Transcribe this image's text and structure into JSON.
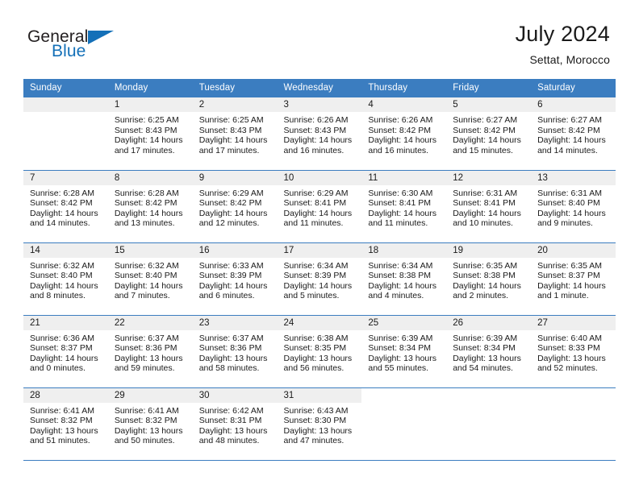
{
  "brand": {
    "word1": "General",
    "word2": "Blue",
    "triangle_icon": "triangle-logo-icon",
    "accent_color": "#1470b8"
  },
  "header": {
    "title": "July 2024",
    "subtitle": "Settat, Morocco"
  },
  "calendar": {
    "header_bg": "#3b7dc0",
    "daynum_bg": "#efefef",
    "columns": [
      "Sunday",
      "Monday",
      "Tuesday",
      "Wednesday",
      "Thursday",
      "Friday",
      "Saturday"
    ],
    "labels": {
      "sunrise": "Sunrise:",
      "sunset": "Sunset:",
      "daylight": "Daylight:"
    },
    "weeks": [
      [
        {
          "day": "",
          "empty": true
        },
        {
          "day": "1",
          "sunrise": "Sunrise: 6:25 AM",
          "sunset": "Sunset: 8:43 PM",
          "daylight1": "Daylight: 14 hours",
          "daylight2": "and 17 minutes."
        },
        {
          "day": "2",
          "sunrise": "Sunrise: 6:25 AM",
          "sunset": "Sunset: 8:43 PM",
          "daylight1": "Daylight: 14 hours",
          "daylight2": "and 17 minutes."
        },
        {
          "day": "3",
          "sunrise": "Sunrise: 6:26 AM",
          "sunset": "Sunset: 8:43 PM",
          "daylight1": "Daylight: 14 hours",
          "daylight2": "and 16 minutes."
        },
        {
          "day": "4",
          "sunrise": "Sunrise: 6:26 AM",
          "sunset": "Sunset: 8:42 PM",
          "daylight1": "Daylight: 14 hours",
          "daylight2": "and 16 minutes."
        },
        {
          "day": "5",
          "sunrise": "Sunrise: 6:27 AM",
          "sunset": "Sunset: 8:42 PM",
          "daylight1": "Daylight: 14 hours",
          "daylight2": "and 15 minutes."
        },
        {
          "day": "6",
          "sunrise": "Sunrise: 6:27 AM",
          "sunset": "Sunset: 8:42 PM",
          "daylight1": "Daylight: 14 hours",
          "daylight2": "and 14 minutes."
        }
      ],
      [
        {
          "day": "7",
          "sunrise": "Sunrise: 6:28 AM",
          "sunset": "Sunset: 8:42 PM",
          "daylight1": "Daylight: 14 hours",
          "daylight2": "and 14 minutes."
        },
        {
          "day": "8",
          "sunrise": "Sunrise: 6:28 AM",
          "sunset": "Sunset: 8:42 PM",
          "daylight1": "Daylight: 14 hours",
          "daylight2": "and 13 minutes."
        },
        {
          "day": "9",
          "sunrise": "Sunrise: 6:29 AM",
          "sunset": "Sunset: 8:42 PM",
          "daylight1": "Daylight: 14 hours",
          "daylight2": "and 12 minutes."
        },
        {
          "day": "10",
          "sunrise": "Sunrise: 6:29 AM",
          "sunset": "Sunset: 8:41 PM",
          "daylight1": "Daylight: 14 hours",
          "daylight2": "and 11 minutes."
        },
        {
          "day": "11",
          "sunrise": "Sunrise: 6:30 AM",
          "sunset": "Sunset: 8:41 PM",
          "daylight1": "Daylight: 14 hours",
          "daylight2": "and 11 minutes."
        },
        {
          "day": "12",
          "sunrise": "Sunrise: 6:31 AM",
          "sunset": "Sunset: 8:41 PM",
          "daylight1": "Daylight: 14 hours",
          "daylight2": "and 10 minutes."
        },
        {
          "day": "13",
          "sunrise": "Sunrise: 6:31 AM",
          "sunset": "Sunset: 8:40 PM",
          "daylight1": "Daylight: 14 hours",
          "daylight2": "and 9 minutes."
        }
      ],
      [
        {
          "day": "14",
          "sunrise": "Sunrise: 6:32 AM",
          "sunset": "Sunset: 8:40 PM",
          "daylight1": "Daylight: 14 hours",
          "daylight2": "and 8 minutes."
        },
        {
          "day": "15",
          "sunrise": "Sunrise: 6:32 AM",
          "sunset": "Sunset: 8:40 PM",
          "daylight1": "Daylight: 14 hours",
          "daylight2": "and 7 minutes."
        },
        {
          "day": "16",
          "sunrise": "Sunrise: 6:33 AM",
          "sunset": "Sunset: 8:39 PM",
          "daylight1": "Daylight: 14 hours",
          "daylight2": "and 6 minutes."
        },
        {
          "day": "17",
          "sunrise": "Sunrise: 6:34 AM",
          "sunset": "Sunset: 8:39 PM",
          "daylight1": "Daylight: 14 hours",
          "daylight2": "and 5 minutes."
        },
        {
          "day": "18",
          "sunrise": "Sunrise: 6:34 AM",
          "sunset": "Sunset: 8:38 PM",
          "daylight1": "Daylight: 14 hours",
          "daylight2": "and 4 minutes."
        },
        {
          "day": "19",
          "sunrise": "Sunrise: 6:35 AM",
          "sunset": "Sunset: 8:38 PM",
          "daylight1": "Daylight: 14 hours",
          "daylight2": "and 2 minutes."
        },
        {
          "day": "20",
          "sunrise": "Sunrise: 6:35 AM",
          "sunset": "Sunset: 8:37 PM",
          "daylight1": "Daylight: 14 hours",
          "daylight2": "and 1 minute."
        }
      ],
      [
        {
          "day": "21",
          "sunrise": "Sunrise: 6:36 AM",
          "sunset": "Sunset: 8:37 PM",
          "daylight1": "Daylight: 14 hours",
          "daylight2": "and 0 minutes."
        },
        {
          "day": "22",
          "sunrise": "Sunrise: 6:37 AM",
          "sunset": "Sunset: 8:36 PM",
          "daylight1": "Daylight: 13 hours",
          "daylight2": "and 59 minutes."
        },
        {
          "day": "23",
          "sunrise": "Sunrise: 6:37 AM",
          "sunset": "Sunset: 8:36 PM",
          "daylight1": "Daylight: 13 hours",
          "daylight2": "and 58 minutes."
        },
        {
          "day": "24",
          "sunrise": "Sunrise: 6:38 AM",
          "sunset": "Sunset: 8:35 PM",
          "daylight1": "Daylight: 13 hours",
          "daylight2": "and 56 minutes."
        },
        {
          "day": "25",
          "sunrise": "Sunrise: 6:39 AM",
          "sunset": "Sunset: 8:34 PM",
          "daylight1": "Daylight: 13 hours",
          "daylight2": "and 55 minutes."
        },
        {
          "day": "26",
          "sunrise": "Sunrise: 6:39 AM",
          "sunset": "Sunset: 8:34 PM",
          "daylight1": "Daylight: 13 hours",
          "daylight2": "and 54 minutes."
        },
        {
          "day": "27",
          "sunrise": "Sunrise: 6:40 AM",
          "sunset": "Sunset: 8:33 PM",
          "daylight1": "Daylight: 13 hours",
          "daylight2": "and 52 minutes."
        }
      ],
      [
        {
          "day": "28",
          "sunrise": "Sunrise: 6:41 AM",
          "sunset": "Sunset: 8:32 PM",
          "daylight1": "Daylight: 13 hours",
          "daylight2": "and 51 minutes."
        },
        {
          "day": "29",
          "sunrise": "Sunrise: 6:41 AM",
          "sunset": "Sunset: 8:32 PM",
          "daylight1": "Daylight: 13 hours",
          "daylight2": "and 50 minutes."
        },
        {
          "day": "30",
          "sunrise": "Sunrise: 6:42 AM",
          "sunset": "Sunset: 8:31 PM",
          "daylight1": "Daylight: 13 hours",
          "daylight2": "and 48 minutes."
        },
        {
          "day": "31",
          "sunrise": "Sunrise: 6:43 AM",
          "sunset": "Sunset: 8:30 PM",
          "daylight1": "Daylight: 13 hours",
          "daylight2": "and 47 minutes."
        },
        {
          "day": "",
          "blank": true
        },
        {
          "day": "",
          "blank": true
        },
        {
          "day": "",
          "blank": true
        }
      ]
    ]
  }
}
